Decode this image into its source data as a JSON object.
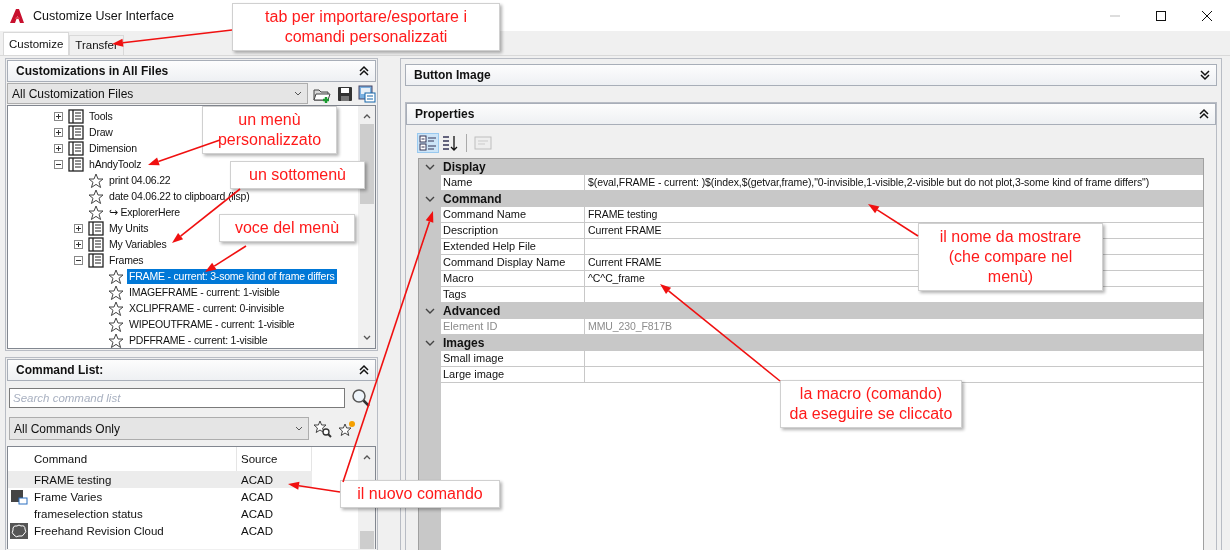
{
  "window": {
    "title": "Customize User Interface"
  },
  "tabs": [
    {
      "label": "Customize",
      "selected": true
    },
    {
      "label": "Transfer",
      "selected": false
    }
  ],
  "customizations": {
    "title": "Customizations in All Files",
    "expanded": true,
    "file_filter": "All Customization Files",
    "tree": [
      {
        "label": "Tools",
        "kind": "menu",
        "expanded": false,
        "selected": false
      },
      {
        "label": "Draw",
        "kind": "menu",
        "expanded": false,
        "selected": false
      },
      {
        "label": "Dimension",
        "kind": "menu",
        "expanded": false,
        "selected": false
      },
      {
        "label": "hAndyToolz",
        "kind": "menu",
        "expanded": true,
        "selected": false,
        "children": [
          {
            "label": "print 04.06.22",
            "kind": "command",
            "selected": false
          },
          {
            "label": "date 04.06.22 to clipboard (lisp)",
            "kind": "command",
            "selected": false
          },
          {
            "label": "↪ ExplorerHere",
            "kind": "command",
            "selected": false
          },
          {
            "label": "My Units",
            "kind": "menu",
            "expanded": false,
            "selected": false
          },
          {
            "label": "My Variables",
            "kind": "menu",
            "expanded": false,
            "selected": false
          },
          {
            "label": "Frames",
            "kind": "menu",
            "expanded": true,
            "selected": false,
            "children": [
              {
                "label": "FRAME - current: 3-some kind of frame differs",
                "kind": "command",
                "selected": true
              },
              {
                "label": "IMAGEFRAME - current: 1-visible",
                "kind": "command",
                "selected": false
              },
              {
                "label": "XCLIPFRAME - current: 0-invisible",
                "kind": "command",
                "selected": false
              },
              {
                "label": "WIPEOUTFRAME - current: 1-visible",
                "kind": "command",
                "selected": false
              },
              {
                "label": "PDFFRAME - current: 1-visible",
                "kind": "command",
                "selected": false
              }
            ]
          }
        ]
      }
    ]
  },
  "command_list": {
    "title": "Command List:",
    "expanded": true,
    "search": {
      "placeholder": "Search command list"
    },
    "filter": "All Commands Only",
    "columns": [
      "Command",
      "Source"
    ],
    "rows": [
      {
        "command": "FRAME testing",
        "source": "ACAD",
        "kind": "plain",
        "selected": true
      },
      {
        "command": "Frame Varies",
        "source": "ACAD",
        "kind": "frame",
        "selected": false
      },
      {
        "command": "frameselection status",
        "source": "ACAD",
        "kind": "plain",
        "selected": false
      },
      {
        "command": "Freehand Revision Cloud",
        "source": "ACAD",
        "kind": "cloud",
        "selected": false
      }
    ]
  },
  "button_image": {
    "title": "Button Image",
    "expanded": false
  },
  "properties": {
    "title": "Properties",
    "expanded": true,
    "categorized": true,
    "categories": [
      {
        "name": "Display",
        "expanded": true,
        "rows": [
          {
            "name": "Name",
            "value": "$(eval,FRAME - current: )$(index,$(getvar,frame),\"0-invisible,1-visible,2-visible but do not plot,3-some kind of frame differs\")",
            "disabled": false
          }
        ]
      },
      {
        "name": "Command",
        "expanded": true,
        "rows": [
          {
            "name": "Command Name",
            "value": "FRAME testing",
            "disabled": false
          },
          {
            "name": "Description",
            "value": "Current FRAME",
            "disabled": false
          },
          {
            "name": "Extended Help File",
            "disabled": false
          },
          {
            "name": "Command Display Name",
            "value": "Current FRAME",
            "disabled": false
          },
          {
            "name": "Macro",
            "value": "^C^C_frame",
            "disabled": false
          },
          {
            "name": "Tags",
            "disabled": false
          }
        ]
      },
      {
        "name": "Advanced",
        "expanded": true,
        "rows": [
          {
            "name": "Element ID",
            "value": "MMU_230_F817B",
            "disabled": true
          }
        ]
      },
      {
        "name": "Images",
        "expanded": true,
        "rows": [
          {
            "name": "Small image",
            "disabled": false
          },
          {
            "name": "Large image",
            "disabled": false
          }
        ]
      }
    ]
  },
  "annotations": [
    {
      "text": "tab per importare/esportare i\ncomandi personalizzati"
    },
    {
      "text": "un menù\npersonalizzato"
    },
    {
      "text": "un sottomenù"
    },
    {
      "text": "voce del menù"
    },
    {
      "text": "il nome da mostrare\n(che compare nel\nmenù)"
    },
    {
      "text": "la macro (comando)\nda eseguire se cliccato"
    },
    {
      "text": "il nuovo comando"
    }
  ]
}
